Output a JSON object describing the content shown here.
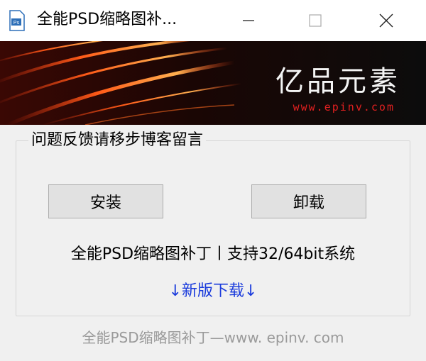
{
  "window": {
    "title": "全能PSD缩略图补..."
  },
  "banner": {
    "brand_name": "亿品元素",
    "brand_url": "www.epinv.com"
  },
  "group": {
    "legend": "问题反馈请移步博客留言"
  },
  "buttons": {
    "install_label": "安装",
    "uninstall_label": "卸载"
  },
  "info": {
    "support_text": "全能PSD缩略图补丁丨支持32/64bit系统",
    "download_text": "↓新版下载↓"
  },
  "footer": {
    "text": "全能PSD缩略图补丁—www. epinv. com"
  },
  "colors": {
    "link": "#1a3bdc",
    "brand_url": "#e02020"
  }
}
